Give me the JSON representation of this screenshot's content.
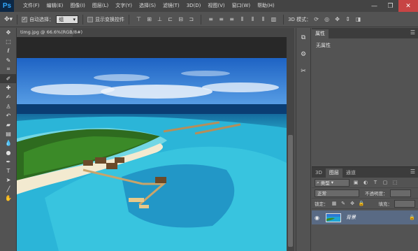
{
  "app": {
    "logo": "Ps"
  },
  "menu": [
    "文件(F)",
    "编辑(E)",
    "图像(I)",
    "图层(L)",
    "文字(Y)",
    "选择(S)",
    "滤镜(T)",
    "3D(D)",
    "视图(V)",
    "窗口(W)",
    "帮助(H)"
  ],
  "window_controls": {
    "minimize": "—",
    "restore": "❐",
    "close": "✕"
  },
  "options": {
    "auto_select_label": "自动选择：",
    "auto_select_value": "组",
    "show_transform_label": "显示变换控件",
    "mode_3d_label": "3D 模式："
  },
  "document": {
    "tab_title": "timg.jpg @ 66.6%(RGB/8#)"
  },
  "properties": {
    "tab_label": "属性",
    "content": "无属性"
  },
  "layers": {
    "tabs": [
      "3D",
      "图层",
      "通道"
    ],
    "kind_label": "类型",
    "blend_mode": "正常",
    "opacity_label": "不透明度：",
    "lock_label": "锁定：",
    "fill_label": "填充：",
    "layer_name": "背景"
  },
  "colors": {
    "ui_bg": "#535353",
    "menubar_bg": "#444444",
    "ps_logo_text": "#31a8ff",
    "selected_layer": "#596a84",
    "close_button": "#c74444"
  }
}
